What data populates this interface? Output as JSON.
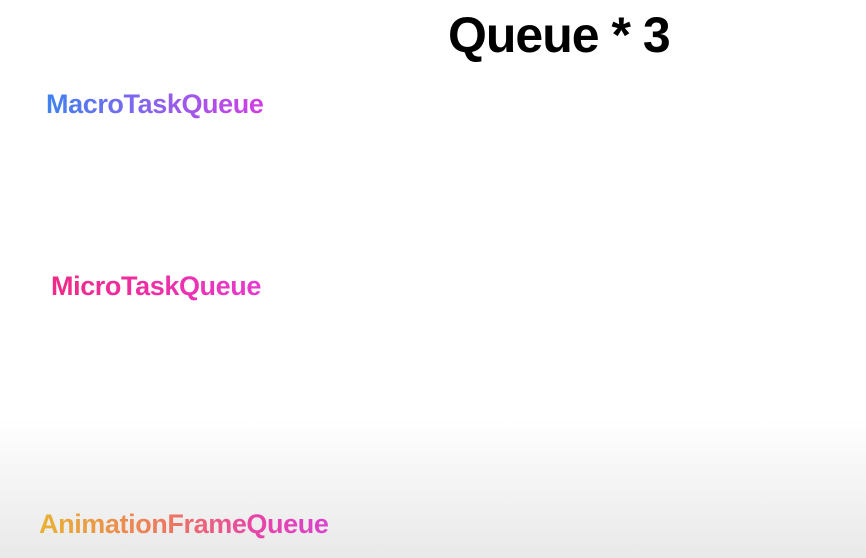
{
  "slide": {
    "title": "Queue * 3",
    "queues": {
      "macro": "MacroTaskQueue",
      "micro": "MicroTaskQueue",
      "animation": "AnimationFrameQueue"
    }
  },
  "colors": {
    "title": "#000000",
    "macro_gradient": [
      "#3f82f0",
      "#8a62ee",
      "#d13ee4"
    ],
    "micro_gradient": [
      "#f02a86",
      "#ee2fa6",
      "#e53ad0"
    ],
    "animation_gradient": [
      "#e8b232",
      "#ec7860",
      "#e843a8",
      "#d943cc"
    ]
  }
}
